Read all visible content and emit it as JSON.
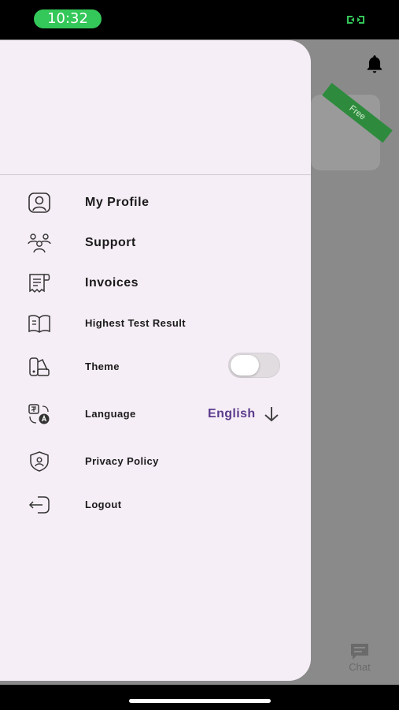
{
  "status_bar": {
    "time": "10:32"
  },
  "background": {
    "ribbon": "Free",
    "chat_tab": "Chat"
  },
  "menu": {
    "items": [
      {
        "label": "My Profile",
        "icon": "profile-icon"
      },
      {
        "label": "Support",
        "icon": "support-icon"
      },
      {
        "label": "Invoices",
        "icon": "invoice-icon"
      },
      {
        "label": "Highest Test Result",
        "icon": "book-icon"
      },
      {
        "label": "Theme",
        "icon": "theme-icon"
      },
      {
        "label": "Language",
        "icon": "translate-icon"
      },
      {
        "label": "Privacy Policy",
        "icon": "shield-user-icon"
      },
      {
        "label": "Logout",
        "icon": "logout-icon"
      }
    ],
    "theme_toggle": {
      "on": false
    },
    "language": {
      "value": "English"
    }
  },
  "colors": {
    "accent": "#5b3b8c",
    "status_green": "#34c759",
    "ribbon_green": "#2e8b3d",
    "drawer_bg": "#f6eef6"
  }
}
